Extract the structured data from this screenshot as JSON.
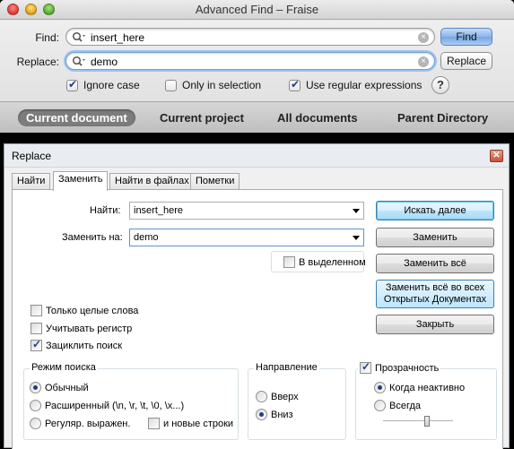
{
  "mac": {
    "title": "Advanced Find – Fraise",
    "find_label": "Find:",
    "replace_label": "Replace:",
    "find_value": "insert_here",
    "replace_value": "demo",
    "find_button": "Find",
    "replace_button": "Replace",
    "ignore_case": "Ignore case",
    "only_in_selection": "Only in selection",
    "use_regex": "Use regular expressions",
    "help": "?",
    "scopes": [
      "Current document",
      "Current project",
      "All documents",
      "Parent Directory"
    ]
  },
  "win": {
    "title": "Replace",
    "close": "✕",
    "tabs": [
      "Найти",
      "Заменить",
      "Найти в файлах",
      "Пометки"
    ],
    "find_label": "Найти:",
    "find_value": "insert_here",
    "replace_label": "Заменить на:",
    "replace_value": "demo",
    "in_selection": "В выделенном",
    "buttons": {
      "find_next": "Искать далее",
      "replace": "Заменить",
      "replace_all": "Заменить всё",
      "replace_all_open_1": "Заменить всё во всех",
      "replace_all_open_2": "Открытых Документах",
      "close": "Закрыть"
    },
    "whole_word": "Только целые слова",
    "match_case": "Учитывать регистр",
    "wrap_around": "Зациклить поиск",
    "search_mode": {
      "title": "Режим поиска",
      "normal": "Обычный",
      "extended": "Расширенный (\\n, \\r, \\t, \\0, \\x...)",
      "regex": "Регуляр. выражен.",
      "dot_newline": "и новые строки"
    },
    "direction": {
      "title": "Направление",
      "up": "Вверх",
      "down": "Вниз"
    },
    "transparency": {
      "title": "Прозрачность",
      "on_lose_focus": "Когда неактивно",
      "always": "Всегда"
    }
  }
}
